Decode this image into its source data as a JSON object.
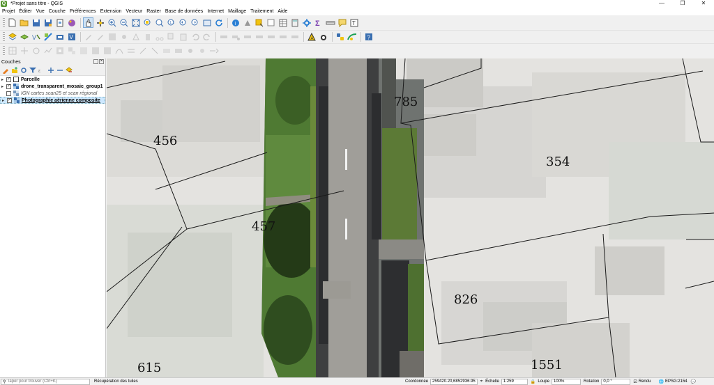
{
  "window": {
    "title": "*Projet sans titre - QGIS",
    "app_icon": "Q",
    "min": "—",
    "max": "❐",
    "close": "✕"
  },
  "menu": [
    "Projet",
    "Éditer",
    "Vue",
    "Couche",
    "Préférences",
    "Extension",
    "Vecteur",
    "Raster",
    "Base de données",
    "Internet",
    "Maillage",
    "Traitement",
    "Aide"
  ],
  "layers_panel": {
    "title": "Couches",
    "layers": [
      {
        "name": "Parcelle",
        "checked": true,
        "style": "bold"
      },
      {
        "name": "drone_transparent_mosaic_group1",
        "checked": true,
        "style": "bold"
      },
      {
        "name": "IGN cartes scan25 et scan régional",
        "checked": false,
        "style": "italic"
      },
      {
        "name": "Photographie aérienne composite",
        "checked": true,
        "style": "selected"
      }
    ]
  },
  "map": {
    "parcel_labels": [
      "456",
      "785",
      "354",
      "457",
      "826",
      "615",
      "1551"
    ]
  },
  "status": {
    "search_placeholder": "Taper pour trouver (Ctrl+K)",
    "message": "Récupération des tuiles",
    "coord_label": "Coordonnée",
    "coord_value": "259420.20,6852936.95",
    "scale_label": "Échelle",
    "scale_value": "1:259",
    "magnifier_label": "Loupe",
    "magnifier_value": "100%",
    "rotation_label": "Rotation",
    "rotation_value": "0,0 °",
    "render_label": "Rendu",
    "crs": "EPSG:2154"
  },
  "colors": {
    "accent": "#589632",
    "selection": "#cde8ff",
    "parcel_line": "#1a1a1a"
  }
}
